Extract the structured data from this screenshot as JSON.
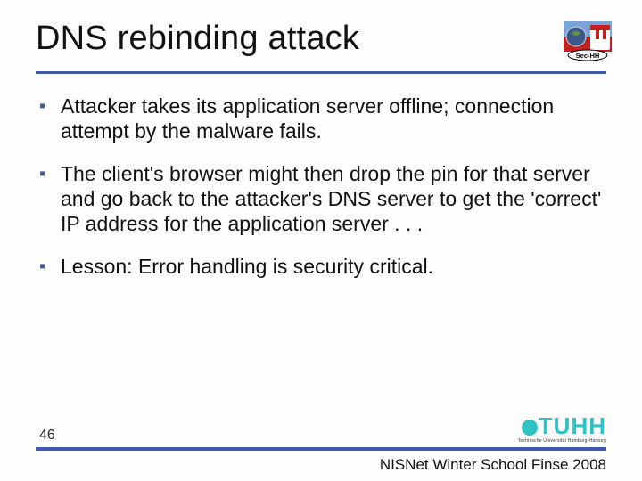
{
  "title": "DNS rebinding attack",
  "bullets": [
    "Attacker takes its application server offline; connection attempt by the malware fails.",
    "The client's browser might then drop the pin for that server and go back to the attacker's DNS server to get the 'correct' IP address for the application server . . .",
    "Lesson: Error handling is security critical."
  ],
  "page_number": "46",
  "footer_text": "NISNet Winter School Finse 2008",
  "top_logo_label": "Sec-HH",
  "bottom_logo": {
    "word": "TUHH",
    "sub": "Technische Universität Hamburg-Harburg"
  },
  "colors": {
    "accent": "#3f5aa8",
    "tuhh": "#2fc2c4"
  }
}
